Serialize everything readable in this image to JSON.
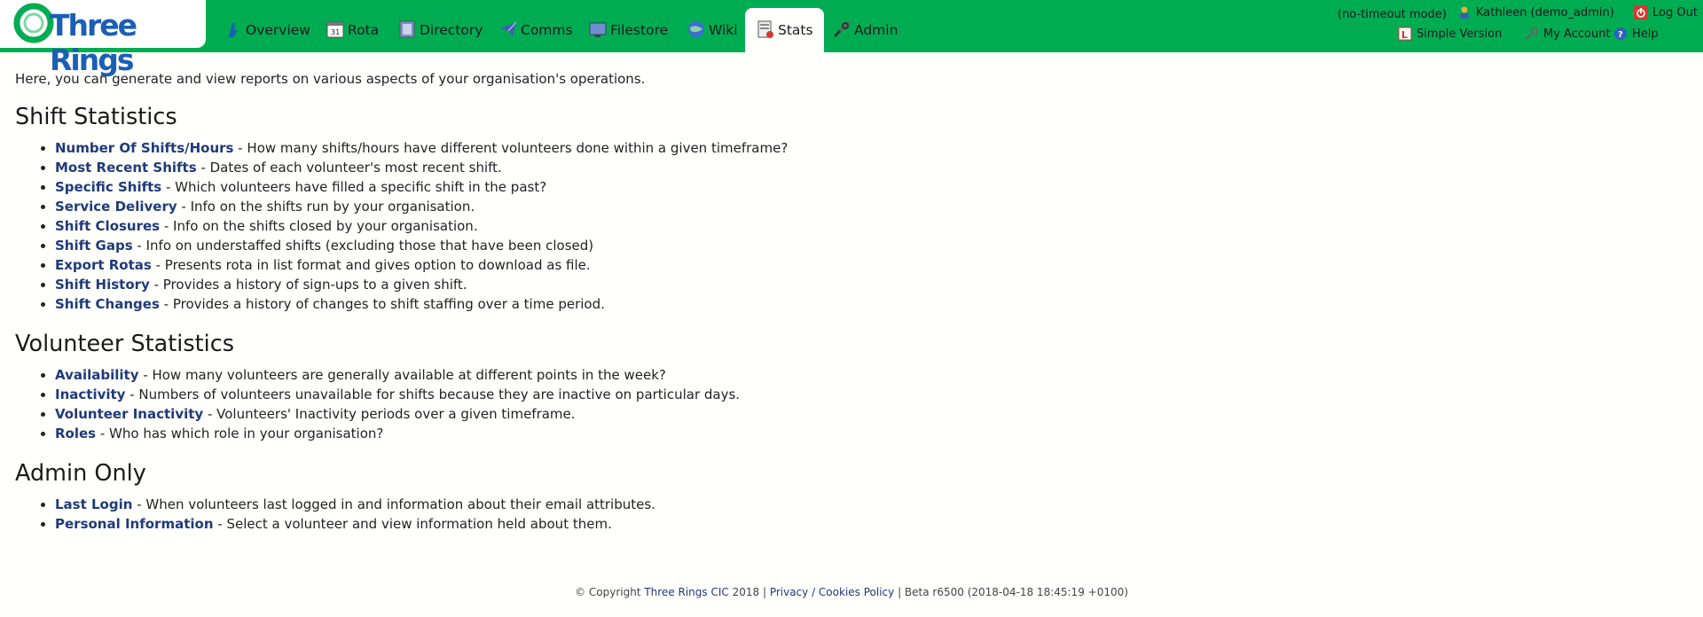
{
  "brand": {
    "name": "Three Rings",
    "accent": "#00ac52",
    "logo_color": "#1a5fb4"
  },
  "nav": [
    {
      "label": "Overview",
      "icon": "overview-icon"
    },
    {
      "label": "Rota",
      "icon": "calendar-icon"
    },
    {
      "label": "Directory",
      "icon": "directory-icon"
    },
    {
      "label": "Comms",
      "icon": "comms-icon"
    },
    {
      "label": "Filestore",
      "icon": "filestore-icon"
    },
    {
      "label": "Wiki",
      "icon": "wiki-icon"
    },
    {
      "label": "Stats",
      "icon": "stats-icon",
      "active": true
    },
    {
      "label": "Admin",
      "icon": "admin-tools-icon"
    }
  ],
  "usertools": {
    "mode": "(no-timeout mode)",
    "user": "Kathleen (demo_admin)",
    "logout": "Log Out",
    "simple_version": "Simple Version",
    "my_account": "My Account",
    "help": "Help"
  },
  "intro": "Here, you can generate and view reports on various aspects of your organisation's operations.",
  "sections": [
    {
      "title": "Shift Statistics",
      "items": [
        {
          "link": "Number Of Shifts/Hours",
          "desc": " - How many shifts/hours have different volunteers done within a given timeframe?"
        },
        {
          "link": "Most Recent Shifts",
          "desc": " - Dates of each volunteer's most recent shift."
        },
        {
          "link": "Specific Shifts",
          "desc": " - Which volunteers have filled a specific shift in the past?"
        },
        {
          "link": "Service Delivery",
          "desc": " - Info on the shifts run by your organisation."
        },
        {
          "link": "Shift Closures",
          "desc": " - Info on the shifts closed by your organisation."
        },
        {
          "link": "Shift Gaps",
          "desc": " - Info on understaffed shifts (excluding those that have been closed)"
        },
        {
          "link": "Export Rotas",
          "desc": " - Presents rota in list format and gives option to download as file."
        },
        {
          "link": "Shift History",
          "desc": " - Provides a history of sign-ups to a given shift."
        },
        {
          "link": "Shift Changes",
          "desc": " - Provides a history of changes to shift staffing over a time period."
        }
      ]
    },
    {
      "title": "Volunteer Statistics",
      "items": [
        {
          "link": "Availability",
          "desc": " - How many volunteers are generally available at different points in the week?"
        },
        {
          "link": "Inactivity",
          "desc": " - Numbers of volunteers unavailable for shifts because they are inactive on particular days."
        },
        {
          "link": "Volunteer Inactivity",
          "desc": " - Volunteers' Inactivity periods over a given timeframe."
        },
        {
          "link": "Roles",
          "desc": " - Who has which role in your organisation?"
        }
      ]
    },
    {
      "title": "Admin Only",
      "items": [
        {
          "link": "Last Login",
          "desc": " - When volunteers last logged in and information about their email attributes."
        },
        {
          "link": "Personal Information",
          "desc": " - Select a volunteer and view information held about them."
        }
      ]
    }
  ],
  "footer": {
    "copyright_prefix": "© Copyright ",
    "company": "Three Rings CIC",
    "year_sep": " 2018 | ",
    "privacy": "Privacy / Cookies Policy",
    "version": " | Beta r6500 (2018-04-18 18:45:19 +0100)"
  }
}
